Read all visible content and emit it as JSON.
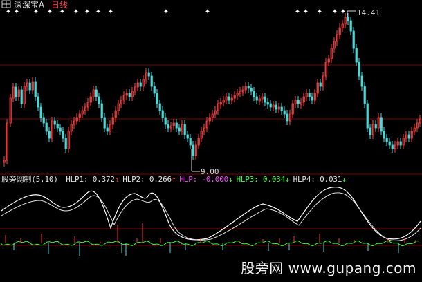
{
  "title_bar": {
    "stock_name": "深深宝A",
    "period": "日线",
    "icon": "checkbox-grid-icon"
  },
  "price_panel": {
    "high_label": "14.41",
    "low_label": "9.00",
    "marker_glyph": "✦",
    "colors": {
      "up": "#ff4040",
      "down": "#44dddd",
      "grid": "#800000",
      "marker": "#ffffff"
    }
  },
  "indicator_panel": {
    "name": "股旁网制",
    "params": "(5,10)",
    "values": [
      {
        "label": "HLP1:",
        "value": "0.372",
        "arrow": "↑",
        "color": "#e0e0e0"
      },
      {
        "label": "HLP2:",
        "value": "0.266",
        "arrow": "↑",
        "color": "#e0e0e0"
      },
      {
        "label": "HLP:",
        "value": "-0.000",
        "arrow": "↓",
        "color": "#ff44ff"
      },
      {
        "label": "HLP3:",
        "value": "0.034",
        "arrow": "↓",
        "color": "#33ff33"
      },
      {
        "label": "HLP4:",
        "value": "0.031",
        "arrow": "↓",
        "color": "#e0e0e0"
      }
    ]
  },
  "watermark": "股旁网 www.gupang.com"
}
